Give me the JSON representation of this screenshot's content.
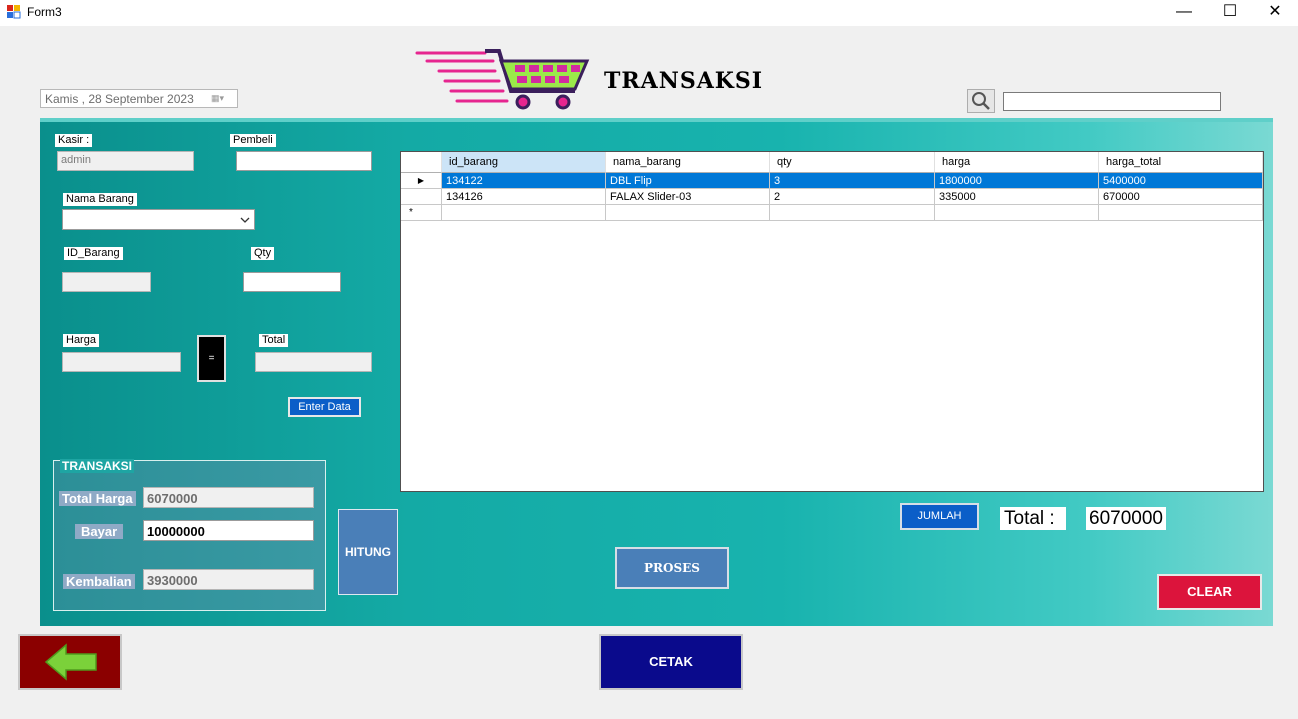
{
  "window": {
    "title": "Form3",
    "minimize": "—",
    "maximize": "☐",
    "close": "✕"
  },
  "header": {
    "title": "TRANSAKSI"
  },
  "date_picker": {
    "value": "Kamis  , 28 September 2023"
  },
  "form": {
    "kasir_label": "Kasir :",
    "kasir_value": "admin",
    "pembeli_label": "Pembeli",
    "pembeli_value": "",
    "nama_barang_label": "Nama Barang",
    "nama_barang_value": "",
    "id_barang_label": "ID_Barang",
    "id_barang_value": "",
    "qty_label": "Qty",
    "qty_value": "",
    "harga_label": "Harga",
    "harga_value": "",
    "equals_label": "=",
    "total_label": "Total",
    "total_value": "",
    "enter_button": "Enter Data"
  },
  "grid": {
    "columns": [
      "id_barang",
      "nama_barang",
      "qty",
      "harga",
      "harga_total"
    ],
    "rows": [
      [
        "134122",
        "DBL Flip",
        "3",
        "1800000",
        "5400000"
      ],
      [
        "134126",
        "FALAX Slider-03",
        "2",
        "335000",
        "670000"
      ]
    ],
    "current_row_marker": "▶",
    "new_row_marker": "*"
  },
  "transaksi": {
    "legend": "TRANSAKSI",
    "total_harga_label": "Total Harga",
    "total_harga_value": "6070000",
    "bayar_label": "Bayar",
    "bayar_value": "10000000",
    "kembalian_label": "Kembalian",
    "kembalian_value": "3930000"
  },
  "buttons": {
    "hitung": "HITUNG",
    "proses": "PROSES",
    "jumlah": "JUMLAH",
    "clear": "CLEAR",
    "cetak": "CETAK"
  },
  "summary": {
    "total_label": "Total  :",
    "total_value": "6070000"
  },
  "colors": {
    "panel_teal": "#14aaa5",
    "clear_red": "#dc143c",
    "cetak_navy": "#0a0a8c",
    "back_darkred": "#8b0000",
    "selection": "#0078d7"
  }
}
